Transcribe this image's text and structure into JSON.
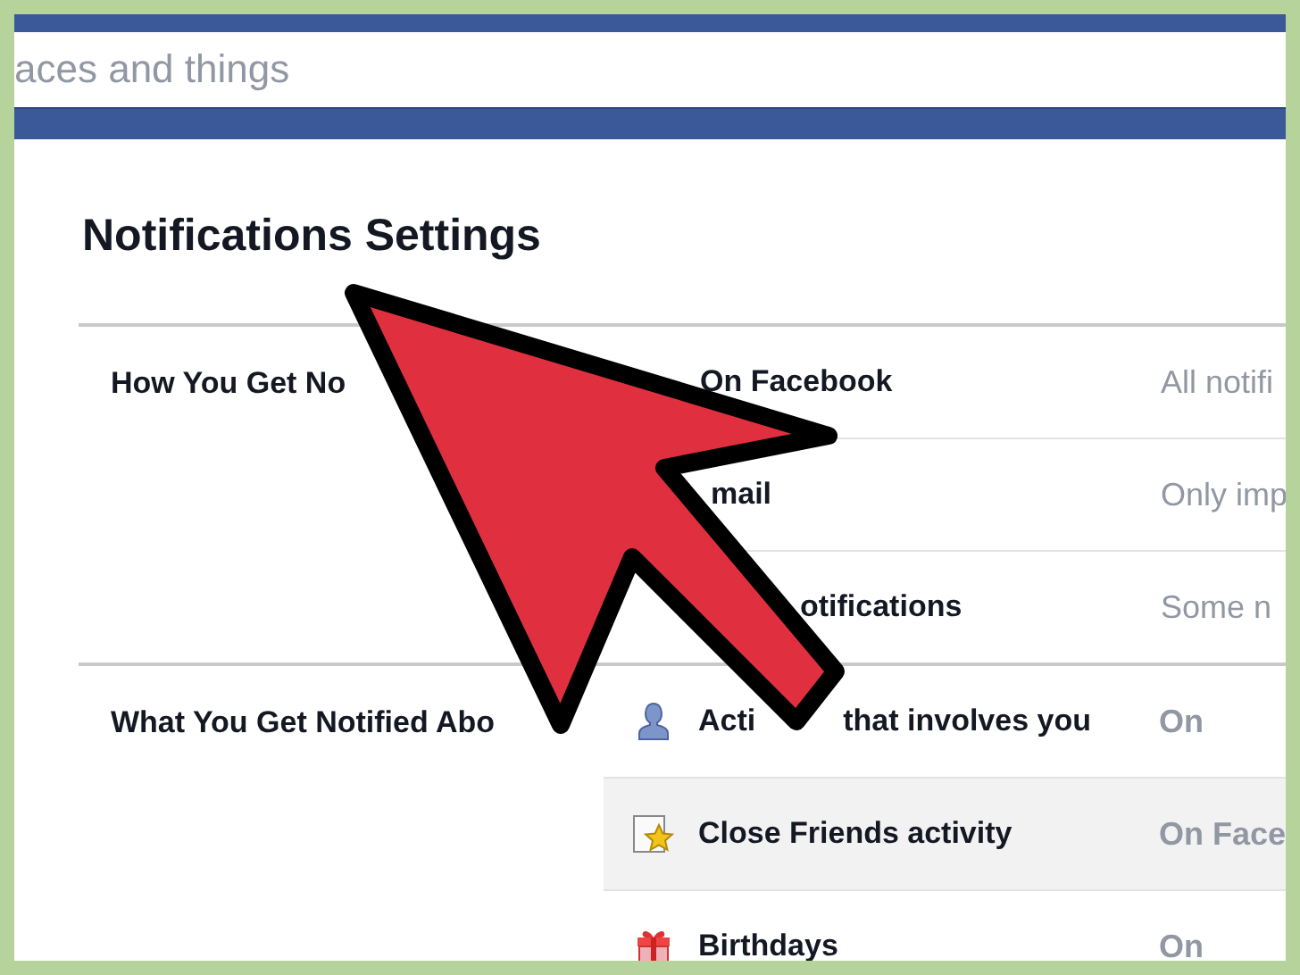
{
  "search": {
    "placeholder": "aces and things"
  },
  "title": "Notifications Settings",
  "sections": [
    {
      "label": "How You Get No",
      "rows": [
        {
          "label": [
            "On Facebook"
          ],
          "value": "All notifi",
          "highlighted": false
        },
        {
          "label": [
            "mail"
          ],
          "value": "Only imp",
          "highlighted": false
        },
        {
          "label": [
            "otifications"
          ],
          "value": "Some n",
          "highlighted": false
        }
      ]
    },
    {
      "label": "What You Get Notified Abo",
      "rows": [
        {
          "kind": "person",
          "label": [
            "Acti",
            "that involves you"
          ],
          "value": "On",
          "highlighted": false
        },
        {
          "kind": "star",
          "label": [
            "Close Friends activity"
          ],
          "value": "On Face",
          "highlighted": true
        },
        {
          "kind": "gift",
          "label": [
            "Birthdays"
          ],
          "value": "On",
          "highlighted": false
        }
      ]
    }
  ]
}
